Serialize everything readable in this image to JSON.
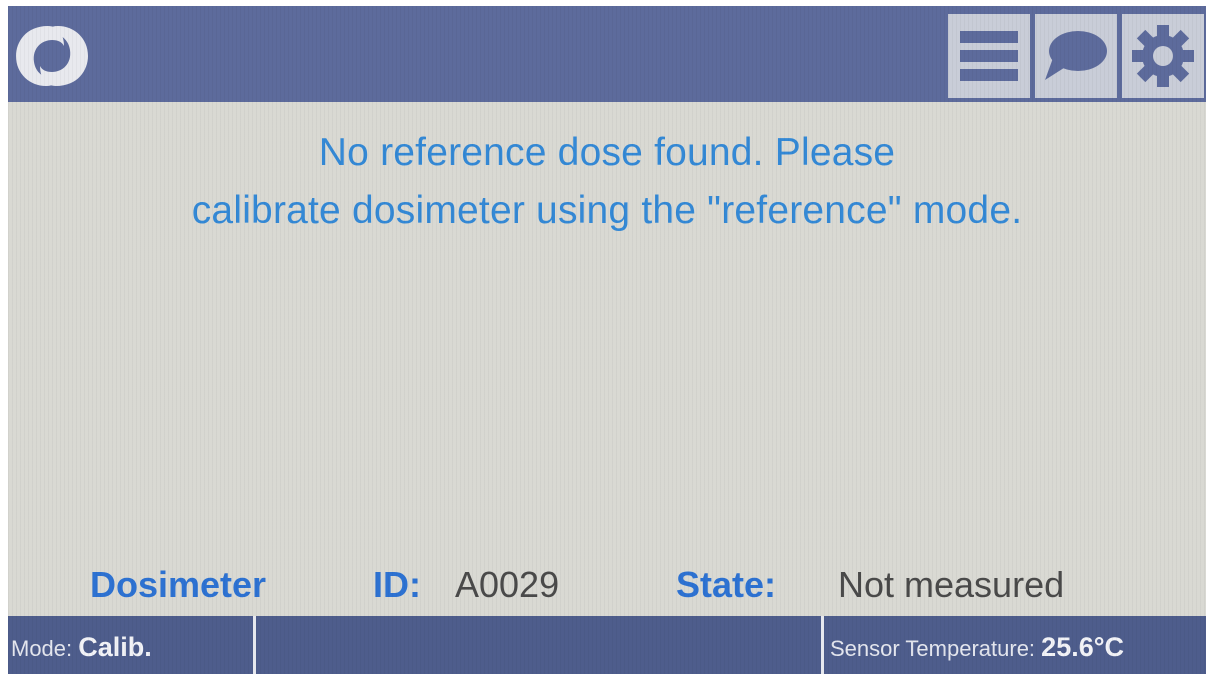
{
  "header": {
    "logo_icon": "logo-icon",
    "buttons": [
      {
        "name": "menu-icon"
      },
      {
        "name": "chat-bubble-icon"
      },
      {
        "name": "gear-icon"
      }
    ]
  },
  "message": {
    "line1": "No reference dose found. Please",
    "line2": "calibrate dosimeter using the \"reference\" mode."
  },
  "info": {
    "dosimeter_label": "Dosimeter",
    "id_label": "ID:",
    "id_value": "A0029",
    "state_label": "State:",
    "state_value": "Not measured"
  },
  "status": {
    "mode_label": "Mode:",
    "mode_value": "Calib.",
    "temp_label": "Sensor Temperature:",
    "temp_value": "25.6°C"
  },
  "colors": {
    "header_bg": "#5d6b9c",
    "screen_bg": "#d9d9d3",
    "message_text": "#3489d6",
    "label_text": "#2d72d2",
    "status_bg": "#4e5d8c"
  }
}
